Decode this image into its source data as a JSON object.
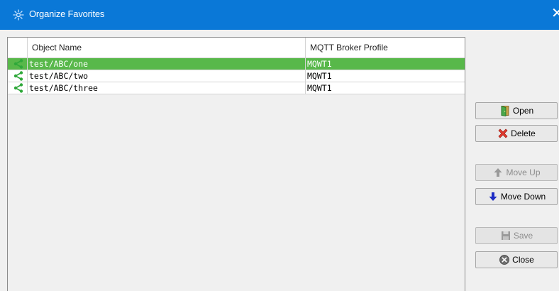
{
  "window": {
    "title": "Organize Favorites",
    "close_glyph": "✕",
    "title_bar_color": "#0a78d7"
  },
  "table": {
    "columns": [
      "",
      "Object Name",
      "MQTT Broker Profile"
    ],
    "rows": [
      {
        "icon": "share-icon",
        "name": "test/ABC/one",
        "profile": "MQWT1",
        "selected": true
      },
      {
        "icon": "share-icon",
        "name": "test/ABC/two",
        "profile": "MQWT1",
        "selected": false
      },
      {
        "icon": "share-icon",
        "name": "test/ABC/three",
        "profile": "MQWT1",
        "selected": false
      }
    ],
    "selection_color": "#58b84a"
  },
  "buttons": {
    "open": {
      "label": "Open",
      "icon": "open-door-icon",
      "enabled": true
    },
    "delete": {
      "label": "Delete",
      "icon": "red-x-icon",
      "enabled": true
    },
    "move_up": {
      "label": "Move Up",
      "icon": "arrow-up-icon",
      "enabled": false
    },
    "move_down": {
      "label": "Move Down",
      "icon": "arrow-down-icon",
      "enabled": true
    },
    "save": {
      "label": "Save",
      "icon": "floppy-disk-icon",
      "enabled": false
    },
    "close": {
      "label": "Close",
      "icon": "close-circle-icon",
      "enabled": true
    }
  }
}
